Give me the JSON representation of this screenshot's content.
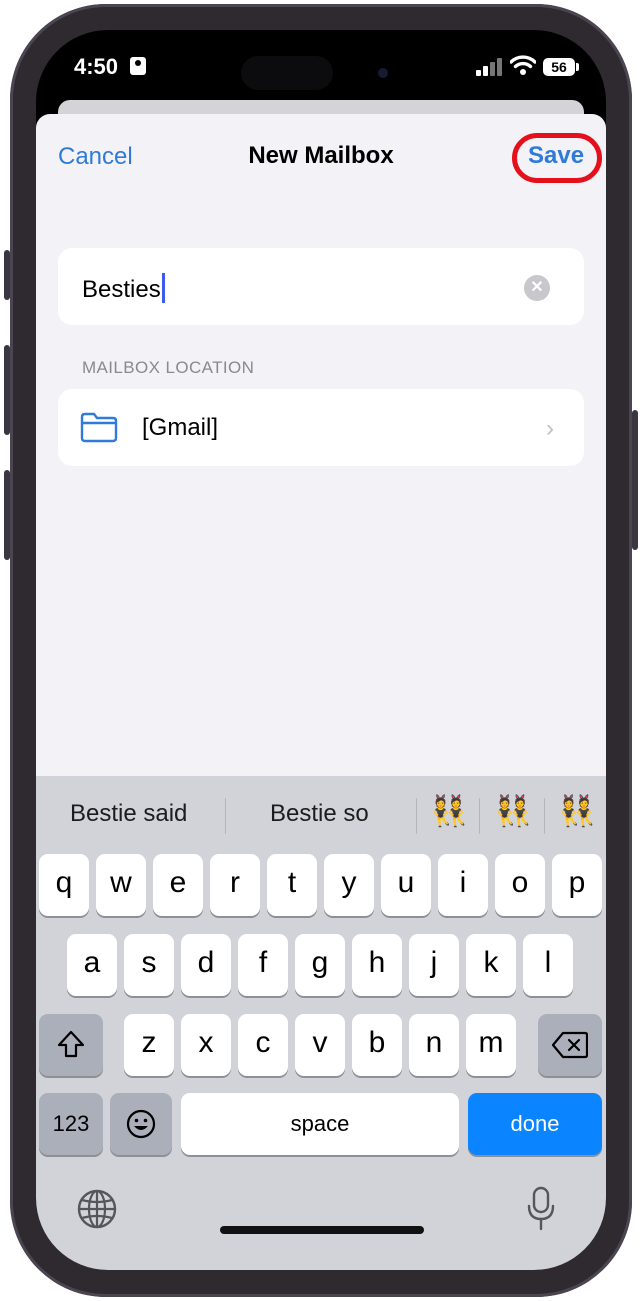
{
  "status_bar": {
    "time": "4:50",
    "battery": "56"
  },
  "nav": {
    "cancel": "Cancel",
    "title": "New Mailbox",
    "save": "Save"
  },
  "name_field": {
    "value": "Besties"
  },
  "location": {
    "header": "MAILBOX LOCATION",
    "label": "[Gmail]"
  },
  "suggestions": {
    "words": [
      "Bestie said",
      "Bestie so"
    ],
    "emojis": [
      "👯",
      "👯",
      "👯"
    ]
  },
  "keyboard": {
    "row1": [
      "q",
      "w",
      "e",
      "r",
      "t",
      "y",
      "u",
      "i",
      "o",
      "p"
    ],
    "row2": [
      "a",
      "s",
      "d",
      "f",
      "g",
      "h",
      "j",
      "k",
      "l"
    ],
    "row3": [
      "z",
      "x",
      "c",
      "v",
      "b",
      "n",
      "m"
    ],
    "numbers": "123",
    "space": "space",
    "done": "done"
  },
  "colors": {
    "accent": "#2f7bd9",
    "highlight_ring": "#e4101c",
    "done_key": "#0a84ff"
  },
  "icons": [
    "id-card-icon",
    "signal-icon",
    "wifi-icon",
    "battery-icon",
    "clear-icon",
    "folder-icon",
    "chevron-right-icon",
    "shift-icon",
    "delete-icon",
    "emoji-icon",
    "globe-icon",
    "microphone-icon"
  ]
}
